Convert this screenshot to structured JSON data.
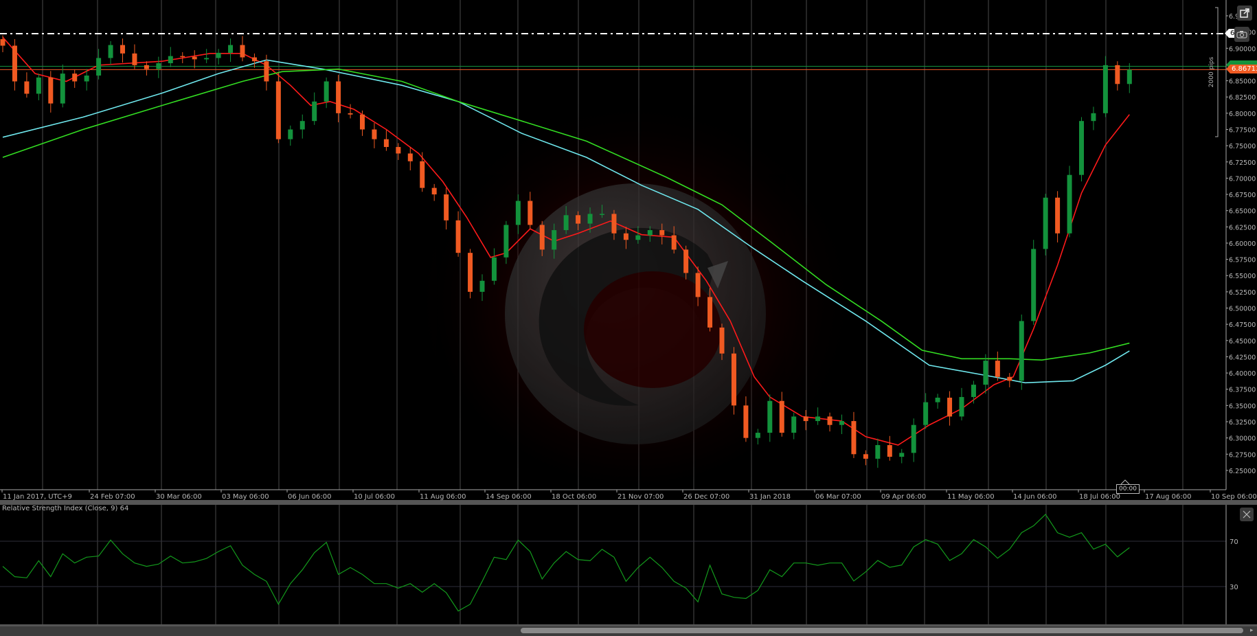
{
  "toolbar": {
    "popout_icon": "external-link-icon",
    "screenshot_icon": "camera-icon",
    "close_icon": "close-icon"
  },
  "price_tags": {
    "current": "6.86713",
    "line": "6.92"
  },
  "measure_label": "2000 pips",
  "crosshair_time": "00:00",
  "rsi": {
    "title": "Relative Strength Index (Close, 9) 64"
  },
  "colors": {
    "background": "#000000",
    "up": "#13923c",
    "down": "#f05a22",
    "ma_fast": "#ff1a1a",
    "ma_slow_cyan": "#6fe8ee",
    "ma_slow_green": "#33dd22",
    "rsi": "#139a1c",
    "price_line": "#f05a22",
    "dashed_line": "#ffffff"
  },
  "chart_data": [
    {
      "type": "candlestick",
      "x_ticks": [
        "11 Jan 2017, UTC+9",
        "24 Feb 07:00",
        "30 Mar 06:00",
        "03 May 06:00",
        "06 Jun 06:00",
        "10 Jul 06:00",
        "11 Aug 06:00",
        "14 Sep 06:00",
        "18 Oct 06:00",
        "21 Nov 07:00",
        "26 Dec 07:00",
        "31 Jan 2018",
        "06 Mar 07:00",
        "09 Apr 06:00",
        "11 May 06:00",
        "14 Jun 06:00",
        "18 Jul 06:00",
        "17 Aug 06:00",
        "10 Sep 06:00"
      ],
      "y_ticks": [
        "6.95",
        "6.92500",
        "6.90000",
        "6.87500",
        "6.85000",
        "6.82500",
        "6.80000",
        "6.77500",
        "6.75000",
        "6.72500",
        "6.70000",
        "6.67500",
        "6.65000",
        "6.62500",
        "6.60000",
        "6.57500",
        "6.55000",
        "6.52500",
        "6.50000",
        "6.47500",
        "6.45000",
        "6.42500",
        "6.40000",
        "6.37500",
        "6.35000",
        "6.32500",
        "6.30000",
        "6.27500",
        "6.25000"
      ],
      "ylim": [
        6.25,
        6.95
      ],
      "grid": true,
      "close": [
        6.904,
        6.849,
        6.83,
        6.855,
        6.815,
        6.861,
        6.849,
        6.858,
        6.885,
        6.905,
        6.892,
        6.874,
        6.868,
        6.877,
        6.888,
        6.887,
        6.883,
        6.885,
        6.893,
        6.905,
        6.886,
        6.88,
        6.849,
        6.76,
        6.775,
        6.788,
        6.818,
        6.849,
        6.8,
        6.798,
        6.775,
        6.76,
        6.748,
        6.738,
        6.726,
        6.685,
        6.675,
        6.635,
        6.585,
        6.525,
        6.542,
        6.578,
        6.628,
        6.665,
        6.628,
        6.59,
        6.62,
        6.643,
        6.63,
        6.645,
        6.645,
        6.615,
        6.605,
        6.612,
        6.62,
        6.612,
        6.59,
        6.554,
        6.517,
        6.47,
        6.43,
        6.35,
        6.3,
        6.308,
        6.357,
        6.308,
        6.333,
        6.326,
        6.333,
        6.32,
        6.326,
        6.275,
        6.268,
        6.289,
        6.271,
        6.277,
        6.32,
        6.355,
        6.362,
        6.333,
        6.363,
        6.382,
        6.419,
        6.394,
        6.388,
        6.48,
        6.591,
        6.67,
        6.615,
        6.705,
        6.788,
        6.8,
        6.874,
        6.845,
        6.86713
      ],
      "moving_averages": [
        {
          "color": "#ff1a1a",
          "points": [
            [
              0,
              6.917
            ],
            [
              2.7,
              6.861
            ],
            [
              5.3,
              6.849
            ],
            [
              8,
              6.874
            ],
            [
              13.3,
              6.88
            ],
            [
              17.3,
              6.892
            ],
            [
              20,
              6.892
            ],
            [
              22,
              6.874
            ],
            [
              24,
              6.843
            ],
            [
              25.7,
              6.812
            ],
            [
              27.3,
              6.818
            ],
            [
              29.3,
              6.806
            ],
            [
              32,
              6.775
            ],
            [
              34.7,
              6.738
            ],
            [
              36.7,
              6.695
            ],
            [
              38.7,
              6.64
            ],
            [
              40.7,
              6.578
            ],
            [
              42,
              6.585
            ],
            [
              44,
              6.622
            ],
            [
              46,
              6.603
            ],
            [
              48,
              6.615
            ],
            [
              50.7,
              6.634
            ],
            [
              53.3,
              6.613
            ],
            [
              56,
              6.609
            ],
            [
              58.7,
              6.542
            ],
            [
              60.7,
              6.48
            ],
            [
              62.7,
              6.394
            ],
            [
              64,
              6.363
            ],
            [
              66.7,
              6.333
            ],
            [
              70,
              6.326
            ],
            [
              72,
              6.302
            ],
            [
              74.7,
              6.289
            ],
            [
              77.3,
              6.32
            ],
            [
              80,
              6.345
            ],
            [
              82.7,
              6.382
            ],
            [
              84.3,
              6.394
            ],
            [
              86,
              6.468
            ],
            [
              88,
              6.566
            ],
            [
              90,
              6.677
            ],
            [
              92,
              6.751
            ],
            [
              94,
              6.798
            ]
          ]
        },
        {
          "color": "#6fe8ee",
          "points": [
            [
              0,
              6.763
            ],
            [
              6.7,
              6.794
            ],
            [
              13.3,
              6.831
            ],
            [
              18,
              6.861
            ],
            [
              22,
              6.882
            ],
            [
              26.7,
              6.868
            ],
            [
              33.3,
              6.843
            ],
            [
              38,
              6.818
            ],
            [
              43.3,
              6.769
            ],
            [
              48.7,
              6.732
            ],
            [
              53.3,
              6.689
            ],
            [
              58,
              6.652
            ],
            [
              62.7,
              6.591
            ],
            [
              66.7,
              6.542
            ],
            [
              72,
              6.48
            ],
            [
              77.3,
              6.412
            ],
            [
              82.7,
              6.394
            ],
            [
              85.3,
              6.385
            ],
            [
              89.3,
              6.388
            ],
            [
              92,
              6.412
            ],
            [
              94,
              6.434
            ]
          ]
        },
        {
          "color": "#33dd22",
          "points": [
            [
              0,
              6.732
            ],
            [
              6.7,
              6.775
            ],
            [
              13.3,
              6.812
            ],
            [
              20,
              6.849
            ],
            [
              23.3,
              6.864
            ],
            [
              28,
              6.868
            ],
            [
              33.3,
              6.849
            ],
            [
              38,
              6.818
            ],
            [
              43.3,
              6.788
            ],
            [
              48.7,
              6.757
            ],
            [
              55.3,
              6.702
            ],
            [
              60,
              6.659
            ],
            [
              64,
              6.603
            ],
            [
              68.7,
              6.536
            ],
            [
              73.3,
              6.48
            ],
            [
              76.7,
              6.435
            ],
            [
              80,
              6.422
            ],
            [
              84,
              6.422
            ],
            [
              86.7,
              6.42
            ],
            [
              90.7,
              6.431
            ],
            [
              94,
              6.446
            ]
          ]
        }
      ],
      "horizontal_lines": [
        {
          "value": 6.9225,
          "style": "dash-dot",
          "color": "#ffffff"
        },
        {
          "value": 6.8723,
          "style": "solid",
          "color": "#13923c"
        },
        {
          "value": 6.86713,
          "style": "solid",
          "color": "#f05a22"
        }
      ]
    },
    {
      "type": "line",
      "title": "Relative Strength Index (Close, 9) 64",
      "y_ticks": [
        "70",
        "30"
      ],
      "ylim": [
        0,
        100
      ],
      "values": [
        47.8,
        38.7,
        37.7,
        52.8,
        38.7,
        58.9,
        50.8,
        55.9,
        56.9,
        71,
        58.9,
        50.8,
        47.8,
        49.8,
        56.9,
        50.8,
        51.8,
        54.8,
        60.9,
        66,
        48.8,
        40.7,
        34.6,
        14.4,
        32.6,
        44.8,
        59.9,
        69,
        40.7,
        46.8,
        40.7,
        32.6,
        32.6,
        28.6,
        32.6,
        25,
        32.6,
        24.6,
        8.4,
        14.4,
        34.6,
        55.9,
        53.8,
        71,
        60.9,
        36.7,
        50.8,
        60.9,
        53.8,
        52.8,
        62.9,
        55.9,
        34.6,
        46.8,
        55.9,
        46.8,
        34.6,
        28.6,
        16.5,
        48.8,
        23.5,
        20.5,
        19.5,
        26.6,
        44.8,
        38.7,
        50.8,
        50.8,
        48.8,
        50.8,
        50.8,
        34.9,
        43,
        53,
        47,
        49,
        65,
        71.4,
        67.4,
        53,
        59,
        71.4,
        65,
        55,
        63,
        77.5,
        83.6,
        93.7,
        77.5,
        73.5,
        77.5,
        63,
        67.4,
        56.2,
        64.3
      ]
    }
  ]
}
